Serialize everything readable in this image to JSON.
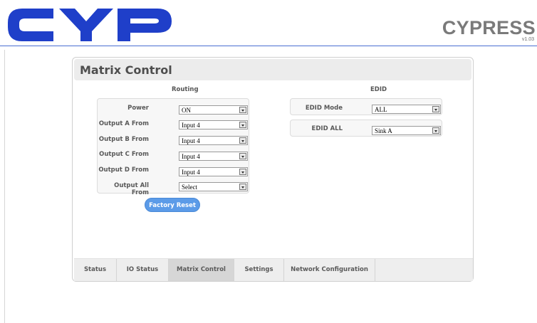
{
  "header": {
    "logo_text": "CYP",
    "brand": "CYPRESS",
    "version": "v1.03"
  },
  "panel": {
    "title": "Matrix Control"
  },
  "routing": {
    "heading": "Routing",
    "rows": [
      {
        "label": "Power",
        "value": "ON"
      },
      {
        "label": "Output A From",
        "value": "Input 4"
      },
      {
        "label": "Output B From",
        "value": "Input 4"
      },
      {
        "label": "Output C From",
        "value": "Input 4"
      },
      {
        "label": "Output D From",
        "value": "Input 4"
      },
      {
        "label": "Output All From",
        "value": "Select"
      }
    ],
    "reset_label": "Factory Reset"
  },
  "edid": {
    "heading": "EDID",
    "rows": [
      {
        "label": "EDID Mode",
        "value": "ALL"
      },
      {
        "label": "EDID ALL",
        "value": "Sink A"
      }
    ]
  },
  "tabs": [
    {
      "label": "Status",
      "active": false
    },
    {
      "label": "IO Status",
      "active": false
    },
    {
      "label": "Matrix Control",
      "active": true
    },
    {
      "label": "Settings",
      "active": false
    },
    {
      "label": "Network Configuration",
      "active": false
    }
  ],
  "colors": {
    "logo_blue": "#1f3fc9",
    "header_line": "#4a6fd1",
    "button_blue": "#5b9be8"
  }
}
